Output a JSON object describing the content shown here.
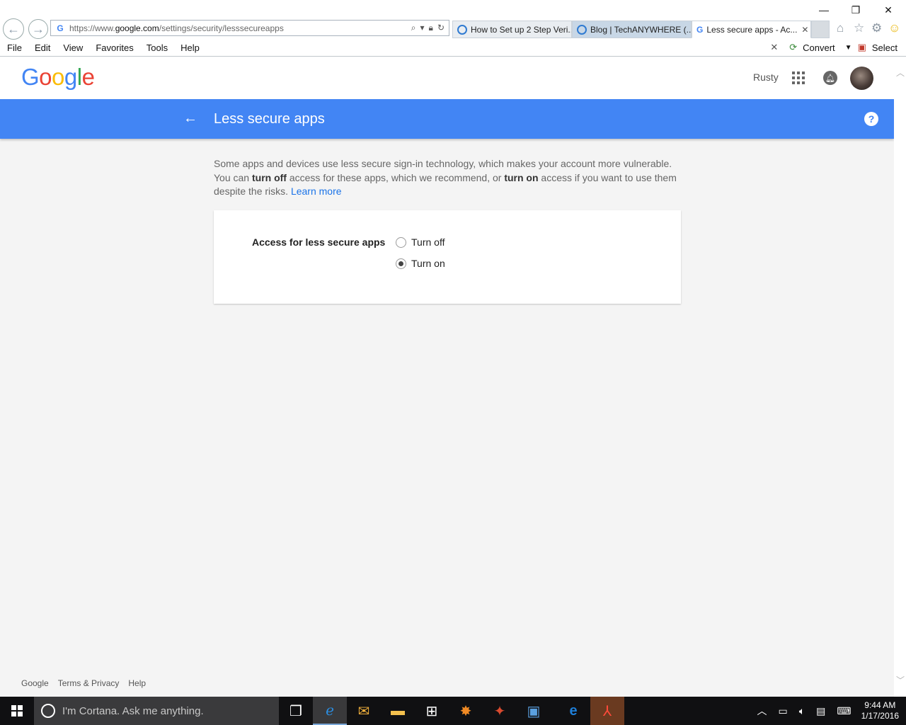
{
  "window": {
    "minimize_glyph": "—",
    "restore_glyph": "❐",
    "close_glyph": "✕"
  },
  "browser": {
    "address": {
      "url_prefix": "https://www.",
      "url_domain": "google.com",
      "url_path": "/settings/security/lesssecureapps"
    },
    "tabs": [
      {
        "label": "How to Set up 2 Step Veri...",
        "icon": "ie-icon"
      },
      {
        "label": "Blog | TechANYWHERE (...",
        "icon": "ie-icon"
      },
      {
        "label": "Less secure apps - Ac...",
        "icon": "google-g-icon"
      }
    ],
    "menu": [
      "File",
      "Edit",
      "View",
      "Favorites",
      "Tools",
      "Help"
    ],
    "command_bar": {
      "convert_label": "Convert",
      "select_label": "Select"
    }
  },
  "google": {
    "logo": [
      {
        "ch": "G",
        "color": "#4285f4"
      },
      {
        "ch": "o",
        "color": "#ea4335"
      },
      {
        "ch": "o",
        "color": "#fbbc05"
      },
      {
        "ch": "g",
        "color": "#4285f4"
      },
      {
        "ch": "l",
        "color": "#34a853"
      },
      {
        "ch": "e",
        "color": "#ea4335"
      }
    ],
    "user_name": "Rusty"
  },
  "page": {
    "title": "Less secure apps",
    "accent_color": "#4285f4",
    "intro": {
      "part1": "Some apps and devices use less secure sign-in technology, which makes your account more vulnerable. You can ",
      "bold1": "turn off",
      "part2": " access for these apps, which we recommend, or ",
      "bold2": "turn on",
      "part3": " access if you want to use them despite the risks. ",
      "link": "Learn more"
    },
    "setting": {
      "label": "Access for less secure apps",
      "options": [
        {
          "label": "Turn off",
          "selected": false
        },
        {
          "label": "Turn on",
          "selected": true
        }
      ]
    }
  },
  "footer": {
    "links": [
      "Google",
      "Terms & Privacy",
      "Help"
    ]
  },
  "taskbar": {
    "cortana_placeholder": "I'm Cortana. Ask me anything.",
    "clock_time": "9:44 AM",
    "clock_date": "1/17/2016"
  }
}
